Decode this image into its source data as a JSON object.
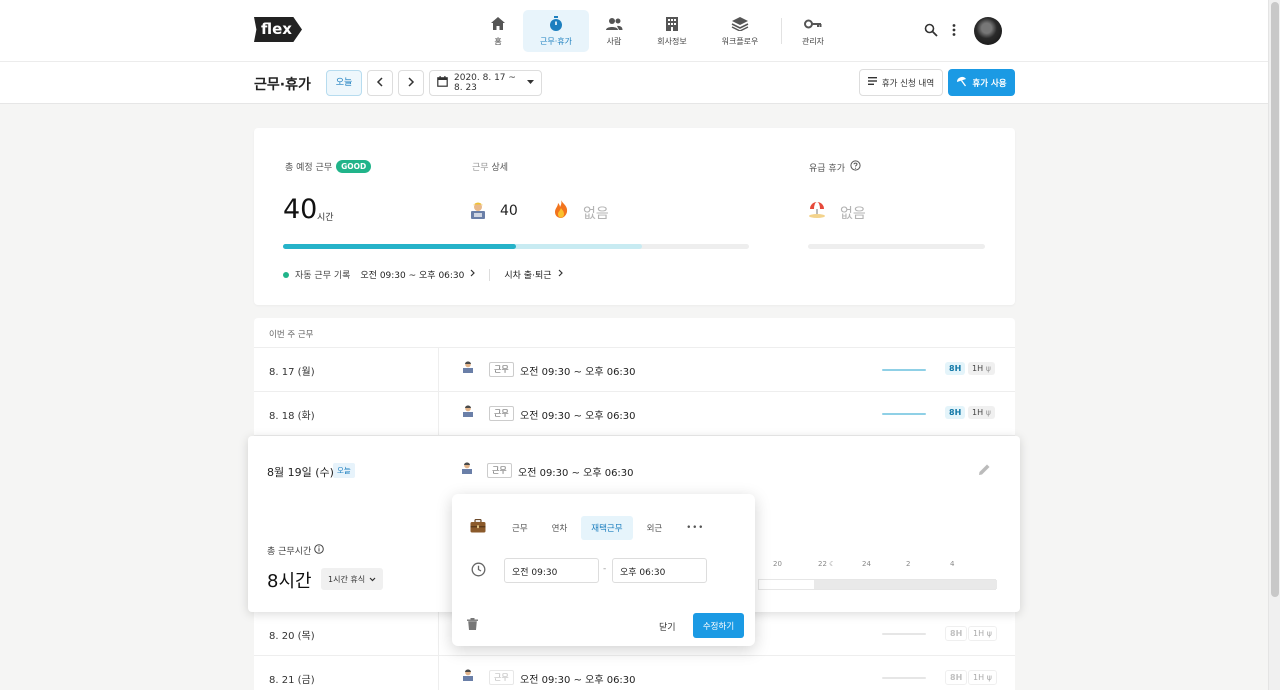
{
  "brand": {
    "logo": "flex"
  },
  "nav": {
    "items": [
      {
        "label": "홈",
        "icon": "home-icon"
      },
      {
        "label": "근무·휴가",
        "icon": "stopwatch-icon"
      },
      {
        "label": "사람",
        "icon": "people-icon"
      },
      {
        "label": "회사정보",
        "icon": "building-icon"
      },
      {
        "label": "워크플로우",
        "icon": "layers-icon"
      },
      {
        "label": "관리자",
        "icon": "key-icon"
      }
    ],
    "active": "근무·휴가"
  },
  "subheader": {
    "title": "근무·휴가",
    "today_button": "오늘",
    "date_range": "2020. 8. 17 ~ 8. 23",
    "history_button": "휴가 신청 내역",
    "use_button": "휴가 사용"
  },
  "summary": {
    "total_label": "총 예정 근무",
    "good_badge": "GOOD",
    "total_value": "40",
    "total_unit": "시간",
    "detail_label": "상세",
    "detail_work_value": "40",
    "detail_overtime_value": "없음",
    "paid_leave_label": "유급 휴가",
    "paid_leave_value": "없음",
    "progress_primary": 0.5,
    "progress_secondary": 0.77,
    "auto_record_label": "자동 근무 기록",
    "auto_record_value": "오전 09:30 ~ 오후 06:30",
    "flex_link": "시차 출·퇴근"
  },
  "weekly": {
    "header": "이번 주 근무",
    "rows": [
      {
        "date": "8. 17 (월)",
        "tag": "근무",
        "time": "오전 09:30 ~ 오후 06:30",
        "hours": "8H",
        "break": "1H"
      },
      {
        "date": "8. 18 (화)",
        "tag": "근무",
        "time": "오전 09:30 ~ 오후 06:30",
        "hours": "8H",
        "break": "1H"
      },
      {
        "date": "8. 20 (목)",
        "tag": "",
        "time": "",
        "hours": "8H",
        "break": "1H"
      },
      {
        "date": "8. 21 (금)",
        "tag": "근무",
        "time": "오전 09:30 ~ 오후 06:30",
        "hours": "8H",
        "break": "1H"
      }
    ],
    "today": {
      "date": "8월 19일 (수)",
      "badge": "오늘",
      "tag": "근무",
      "time": "오전 09:30 ~ 오후 06:30",
      "total_label": "총 근무시간",
      "total_value": "8시간",
      "break_button": "1시간 휴식",
      "timeline_labels": [
        "20",
        "22",
        "24",
        "2",
        "4"
      ]
    }
  },
  "popup": {
    "tabs": [
      "근무",
      "연차",
      "재택근무",
      "외근"
    ],
    "active_tab": "재택근무",
    "more": "•••",
    "start_time": "오전 09:30",
    "end_time": "오후 06:30",
    "separator": "-",
    "close_button": "닫기",
    "save_button": "수정하기"
  },
  "colors": {
    "accent": "#1b9ae4",
    "good": "#21b48a",
    "progress": "#26b3c9",
    "progress_light": "#c8ebf2"
  }
}
